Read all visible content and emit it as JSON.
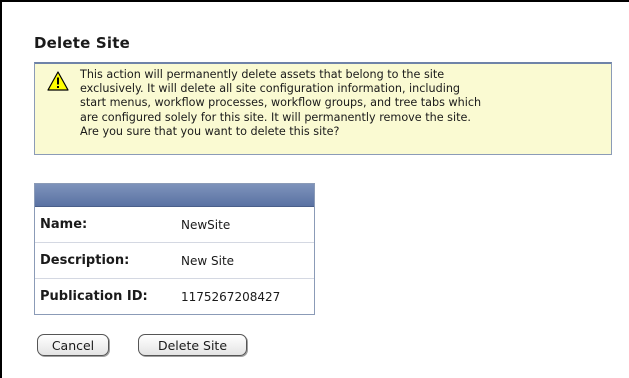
{
  "page": {
    "title": "Delete Site"
  },
  "warning": {
    "icon": "warning-triangle-icon",
    "lines": [
      "This action will permanently delete assets that belong to the site",
      "exclusively. It will delete all site configuration information, including",
      "start menus, workflow processes, workflow groups, and tree tabs which",
      "are configured solely for this site. It will permanently remove the site.",
      "Are you sure that you want to delete this site?"
    ],
    "colors": {
      "background": "#fafad2",
      "icon_fill": "#ffff00"
    }
  },
  "site_info": {
    "rows": [
      {
        "label": "Name:",
        "value": "NewSite"
      },
      {
        "label": "Description:",
        "value": "New Site"
      },
      {
        "label": "Publication ID:",
        "value": "1175267208427"
      }
    ],
    "header_color": "#6b80ad"
  },
  "buttons": {
    "cancel_label": "Cancel",
    "delete_label": "Delete Site"
  }
}
